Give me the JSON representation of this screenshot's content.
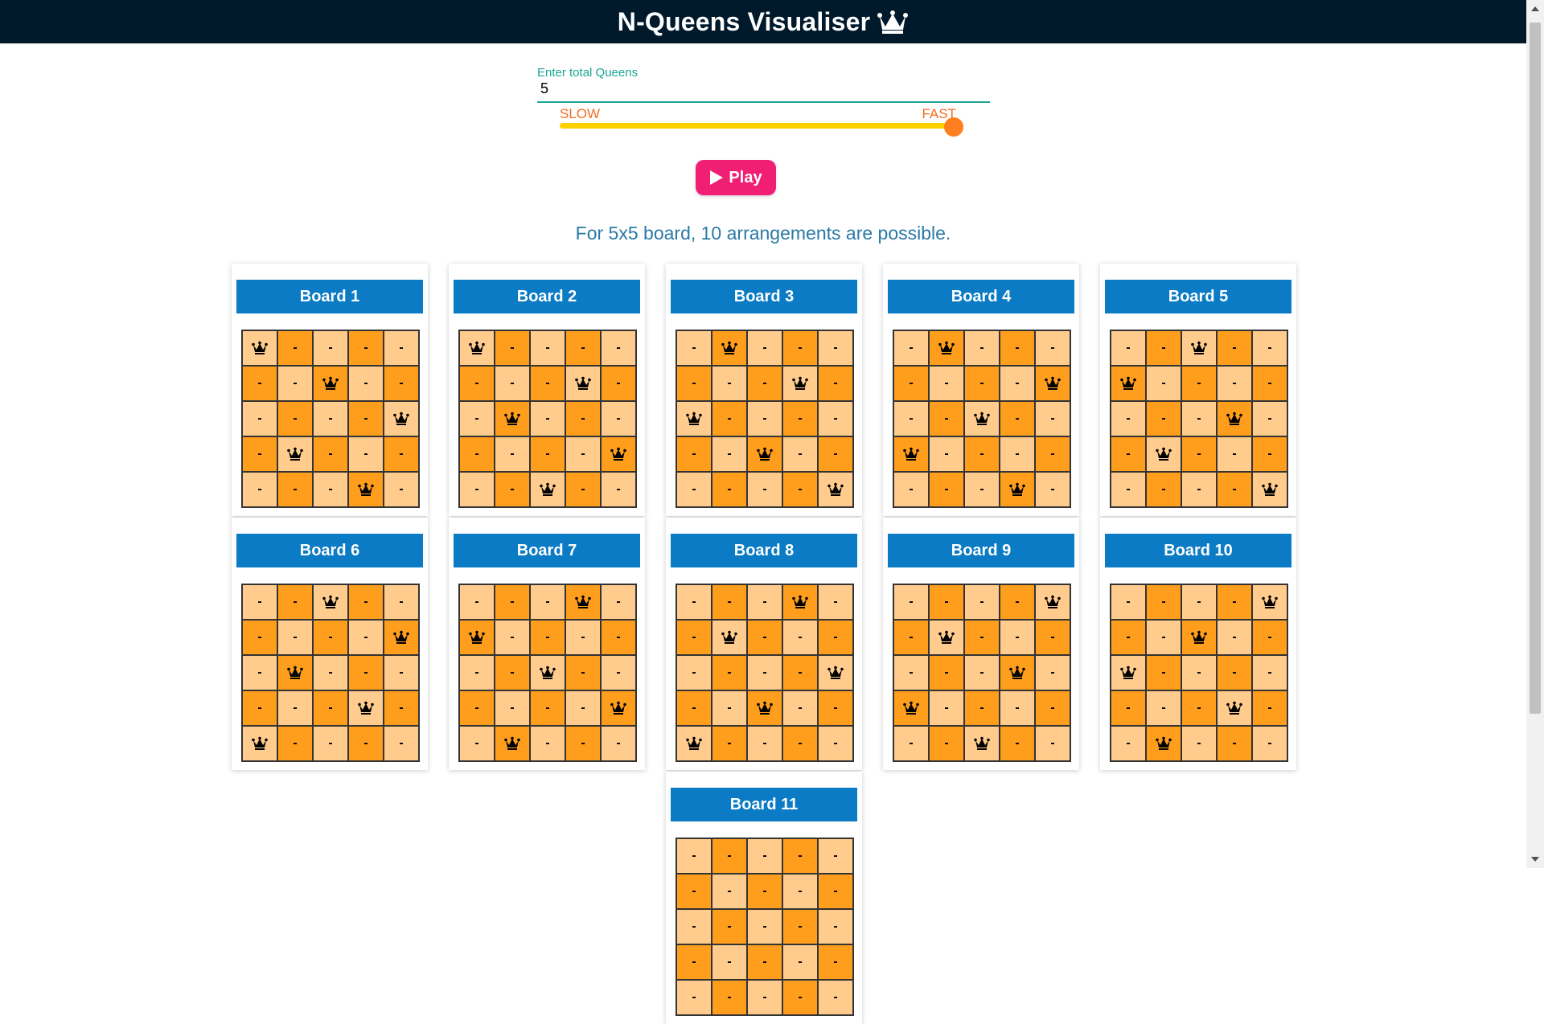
{
  "header": {
    "title": "N-Queens Visualiser",
    "icon": "crown-icon"
  },
  "input": {
    "label": "Enter total Queens",
    "value": "5"
  },
  "speed": {
    "slow_label": "SLOW",
    "fast_label": "FAST",
    "level": 1.0
  },
  "play_button": {
    "label": "Play"
  },
  "summary": "For 5x5 board, 10 arrangements are possible.",
  "board": {
    "size": 5,
    "empty_mark": "-",
    "colors": {
      "light": "#ffcc8e",
      "dark": "#ff9e1c",
      "title": "#0a7bc4"
    }
  },
  "boards": [
    {
      "title": "Board 1",
      "queens": [
        0,
        2,
        4,
        1,
        3
      ]
    },
    {
      "title": "Board 2",
      "queens": [
        0,
        3,
        1,
        4,
        2
      ]
    },
    {
      "title": "Board 3",
      "queens": [
        1,
        3,
        0,
        2,
        4
      ]
    },
    {
      "title": "Board 4",
      "queens": [
        1,
        4,
        2,
        0,
        3
      ]
    },
    {
      "title": "Board 5",
      "queens": [
        2,
        0,
        3,
        1,
        4
      ]
    },
    {
      "title": "Board 6",
      "queens": [
        2,
        4,
        1,
        3,
        0
      ]
    },
    {
      "title": "Board 7",
      "queens": [
        3,
        0,
        2,
        4,
        1
      ]
    },
    {
      "title": "Board 8",
      "queens": [
        3,
        1,
        4,
        2,
        0
      ]
    },
    {
      "title": "Board 9",
      "queens": [
        4,
        1,
        3,
        0,
        2
      ]
    },
    {
      "title": "Board 10",
      "queens": [
        4,
        2,
        0,
        3,
        1
      ]
    },
    {
      "title": "Board 11",
      "queens": []
    }
  ]
}
